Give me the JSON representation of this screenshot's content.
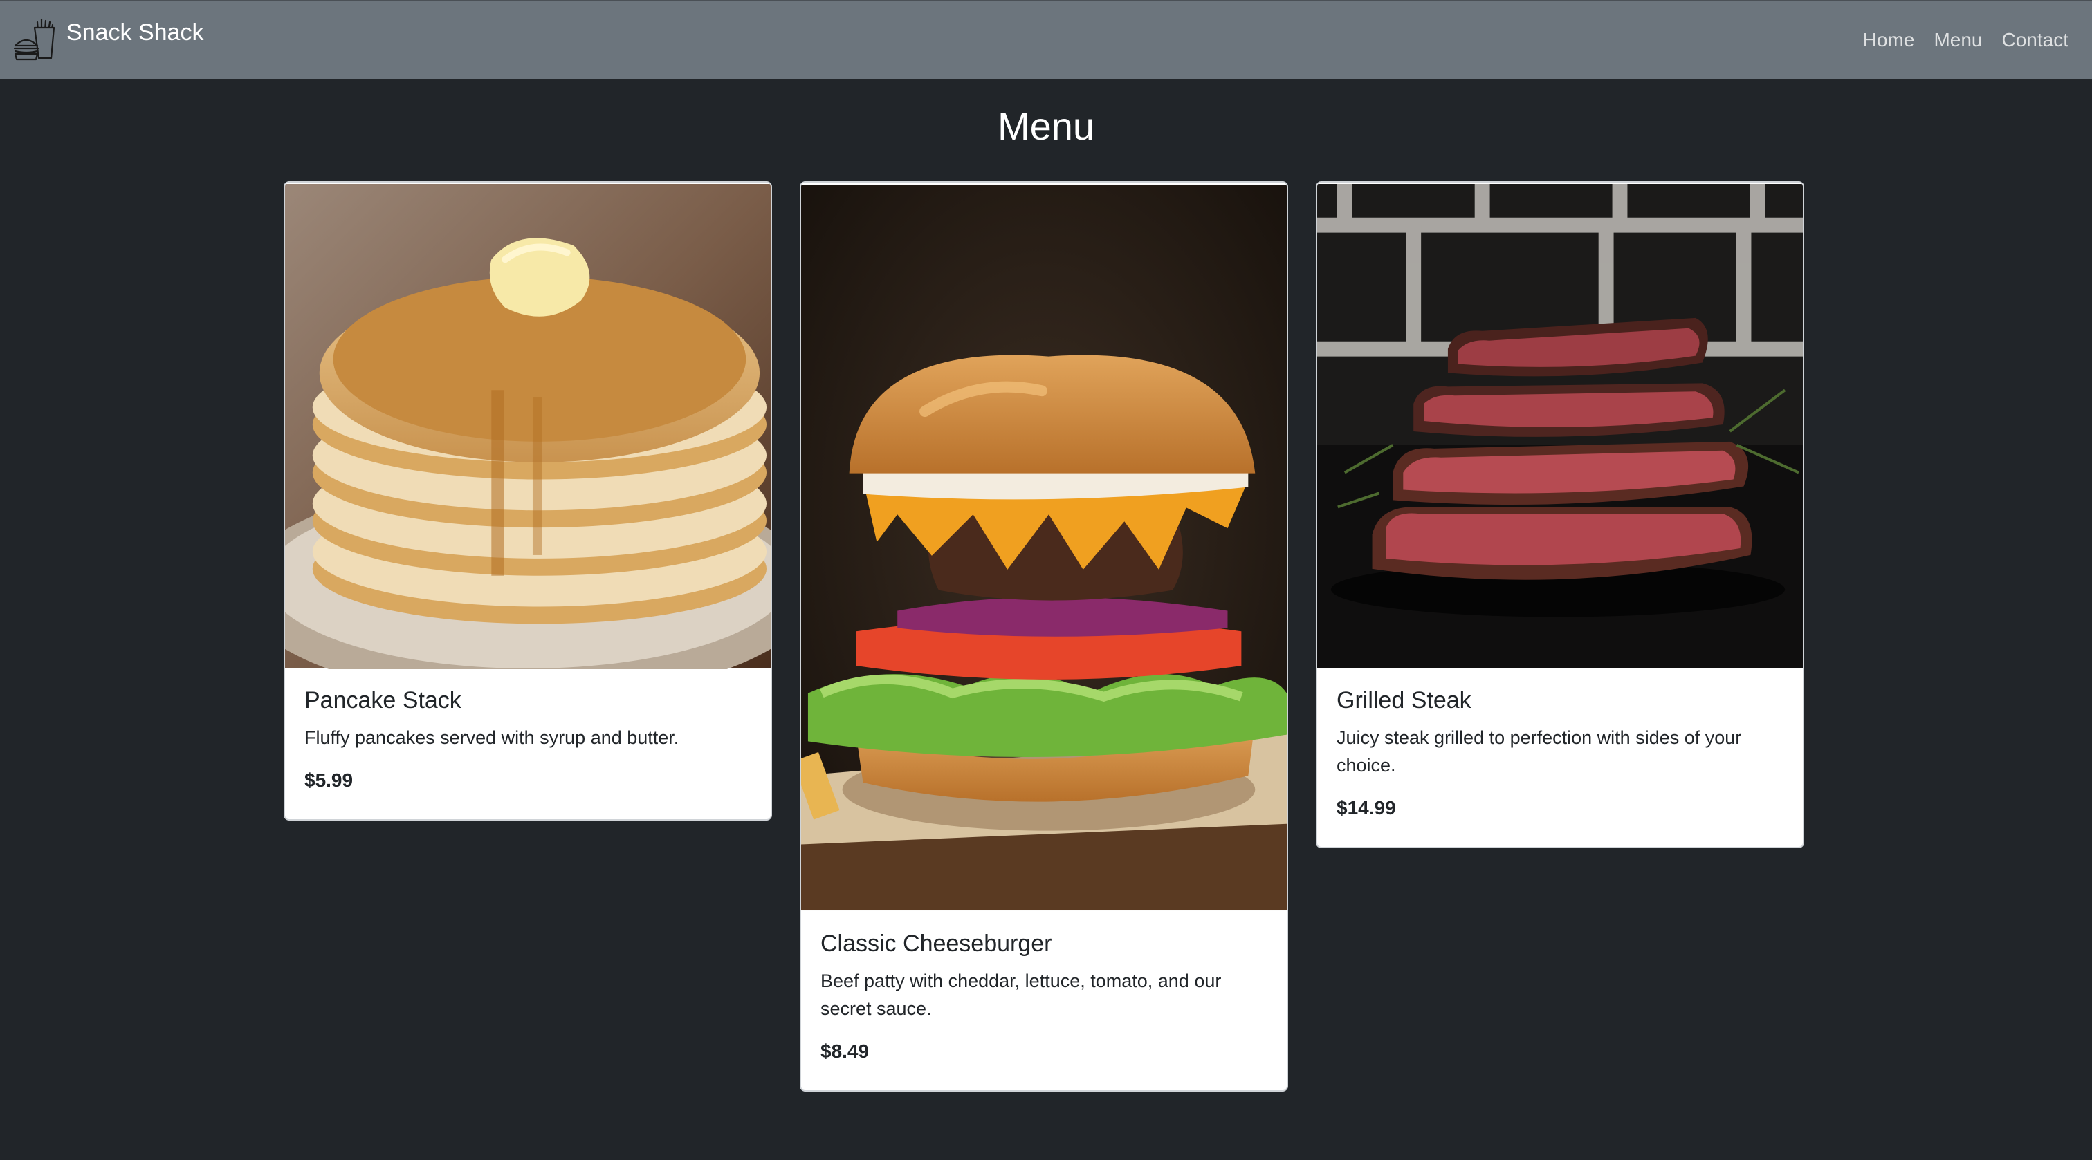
{
  "navbar": {
    "brand_name": "Snack Shack",
    "brand_icon": "fries-and-burger-icon",
    "links": [
      {
        "label": "Home"
      },
      {
        "label": "Menu"
      },
      {
        "label": "Contact"
      }
    ]
  },
  "page": {
    "title": "Menu"
  },
  "menu_items": [
    {
      "name": "Pancake Stack",
      "description": "Fluffy pancakes served with syrup and butter.",
      "price": "$5.99",
      "image": "pancake-stack-photo"
    },
    {
      "name": "Classic Cheeseburger",
      "description": "Beef patty with cheddar, lettuce, tomato, and our secret sauce.",
      "price": "$8.49",
      "image": "cheeseburger-photo"
    },
    {
      "name": "Grilled Steak",
      "description": "Juicy steak grilled to perfection with sides of your choice.",
      "price": "$14.99",
      "image": "grilled-steak-photo"
    }
  ],
  "colors": {
    "navbar_bg": "#6c757d",
    "page_bg": "#212529",
    "card_bg": "#ffffff",
    "text_dark": "#212529"
  }
}
